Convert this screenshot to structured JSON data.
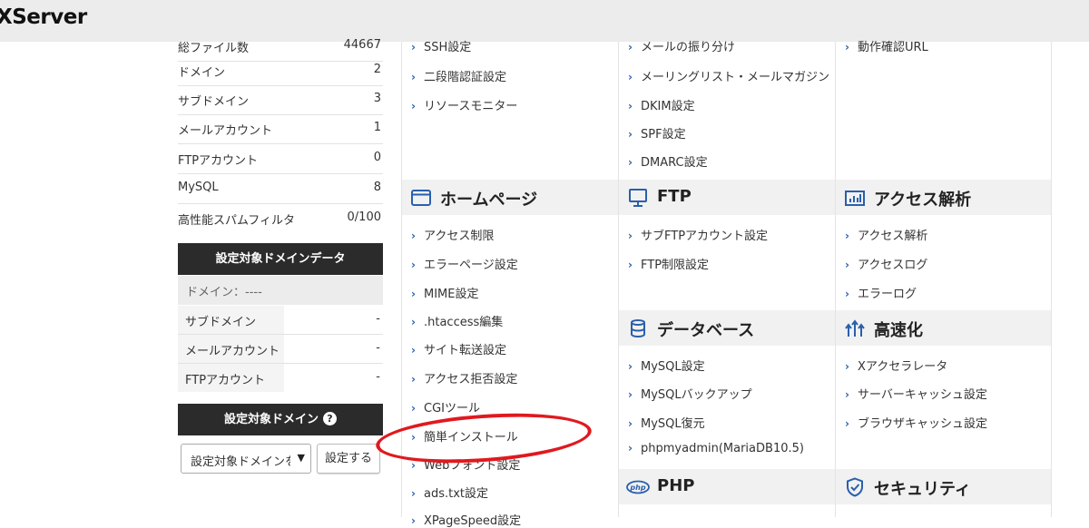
{
  "header": {
    "logo": "XServer"
  },
  "stats": {
    "rows": [
      {
        "label": "総ファイル数",
        "value": "44667"
      },
      {
        "label": "ドメイン",
        "value": "2"
      },
      {
        "label": "サブドメイン",
        "value": "3"
      },
      {
        "label": "メールアカウント",
        "value": "1"
      },
      {
        "label": "FTPアカウント",
        "value": "0"
      },
      {
        "label": "MySQL",
        "value": "8"
      },
      {
        "label": "高性能スパムフィルタ",
        "value": "0/100"
      }
    ]
  },
  "domain_data": {
    "title": "設定対象ドメインデータ",
    "domain_label": "ドメイン：----",
    "rows": [
      {
        "label": "サブドメイン",
        "value": "-"
      },
      {
        "label": "メールアカウント",
        "value": "-"
      },
      {
        "label": "FTPアカウント",
        "value": "-"
      }
    ]
  },
  "target_domain": {
    "title": "設定対象ドメイン",
    "select_value": "設定対象ドメインを選択",
    "button": "設定する"
  },
  "col1_top": [
    "SSH設定",
    "二段階認証設定",
    "リソースモニター"
  ],
  "col2_top": [
    "メールの振り分け",
    "メーリングリスト・メールマガジン",
    "DKIM設定",
    "SPF設定",
    "DMARC設定"
  ],
  "col3_top": [
    "動作確認URL"
  ],
  "homepage": {
    "title": "ホームページ",
    "items": [
      "アクセス制限",
      "エラーページ設定",
      "MIME設定",
      ".htaccess編集",
      "サイト転送設定",
      "アクセス拒否設定",
      "CGIツール",
      "簡単インストール",
      "Webフォント設定",
      "ads.txt設定",
      "XPageSpeed設定"
    ]
  },
  "ftp": {
    "title": "FTP",
    "items": [
      "サブFTPアカウント設定",
      "FTP制限設定"
    ]
  },
  "access": {
    "title": "アクセス解析",
    "items": [
      "アクセス解析",
      "アクセスログ",
      "エラーログ"
    ]
  },
  "database": {
    "title": "データベース",
    "items": [
      "MySQL設定",
      "MySQLバックアップ",
      "MySQL復元",
      "phpmyadmin(MariaDB10.5)"
    ]
  },
  "speed": {
    "title": "高速化",
    "items": [
      "Xアクセラレータ",
      "サーバーキャッシュ設定",
      "ブラウザキャッシュ設定"
    ]
  },
  "php": {
    "title": "PHP"
  },
  "security": {
    "title": "セキュリティ"
  },
  "colors": {
    "accent": "#2a5fad",
    "highlight": "#e0191f",
    "dark": "#2b2b2b"
  }
}
